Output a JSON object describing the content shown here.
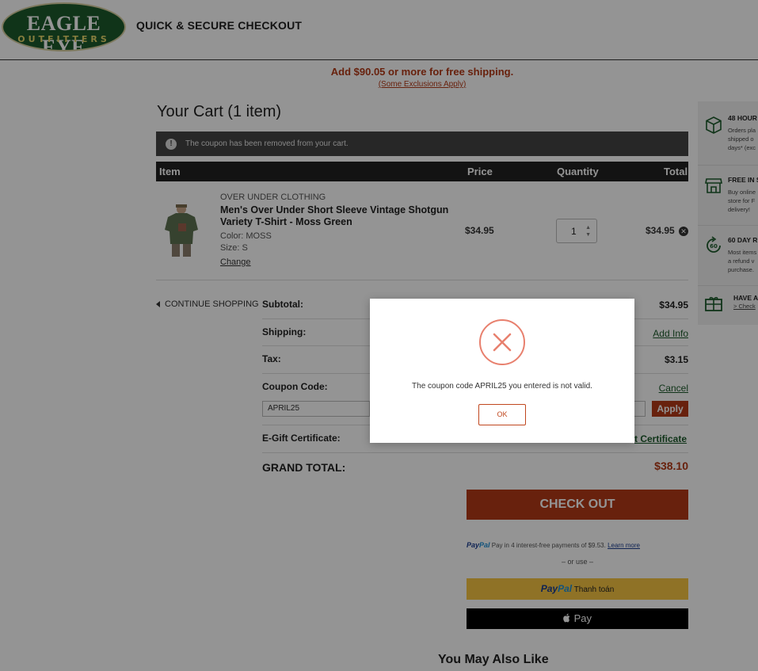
{
  "header": {
    "logo_main": "EAGLE EYE",
    "logo_sub": "OUTFITTERS",
    "title": "QUICK & SECURE CHECKOUT"
  },
  "shipping_banner": {
    "message": "Add $90.05 or more for free shipping.",
    "exclusions": "(Some Exclusions Apply)"
  },
  "cart": {
    "title": "Your Cart (1 item)",
    "notice": "The coupon has been removed from your cart.",
    "columns": [
      "Item",
      "Price",
      "Quantity",
      "Total"
    ],
    "item": {
      "brand": "OVER UNDER CLOTHING",
      "name": "Men's Over Under Short Sleeve Vintage Shotgun Variety T-Shirt - Moss Green",
      "color": "Color: MOSS",
      "size": "Size: S",
      "change": "Change",
      "price": "$34.95",
      "quantity": "1",
      "total": "$34.95"
    },
    "continue_shopping": "CONTINUE SHOPPING"
  },
  "summary": {
    "subtotal_label": "Subtotal:",
    "subtotal_value": "$34.95",
    "shipping_label": "Shipping:",
    "shipping_link": "Add Info",
    "tax_label": "Tax:",
    "tax_value": "$3.15",
    "coupon_label": "Coupon Code:",
    "coupon_cancel": "Cancel",
    "coupon_value": "APRIL25",
    "apply_label": "Apply",
    "egift_label": "E-Gift Certificate:",
    "egift_link": "t Certificate",
    "grand_total_label": "GRAND TOTAL:",
    "grand_total_value": "$38.10"
  },
  "checkout": {
    "button": "CHECK OUT",
    "paypal_logo_a": "Pay",
    "paypal_logo_b": "Pal",
    "paypal_text": "Pay in 4 interest-free payments of $9.53.",
    "paypal_learn": "Learn more",
    "or_use": "– or use –",
    "paypal_button_text": "Thanh toán",
    "applepay_text": "Pay"
  },
  "recommendations": {
    "title": "You May Also Like"
  },
  "side_panel": {
    "items": [
      {
        "icon": "package-icon",
        "title": "48 HOUR",
        "lines": [
          "Orders pla",
          "shipped o",
          "days* (exc"
        ]
      },
      {
        "icon": "store-icon",
        "title": "FREE IN S",
        "lines": [
          "Buy online",
          "store for F",
          "delivery!"
        ]
      },
      {
        "icon": "return-60-icon",
        "title": "60 DAY R",
        "lines": [
          "Most items",
          "a refund v",
          "purchase."
        ]
      },
      {
        "icon": "gift-icon",
        "title": "HAVE A",
        "lines": [
          "> Check"
        ]
      }
    ]
  },
  "modal": {
    "message": "The coupon code APRIL25 you entered is not valid.",
    "ok_label": "OK"
  },
  "colors": {
    "brand_green": "#1d5b2b",
    "accent_orange": "#b33a17",
    "paypal_yellow": "#f6c443",
    "error_red": "#e8806e"
  }
}
